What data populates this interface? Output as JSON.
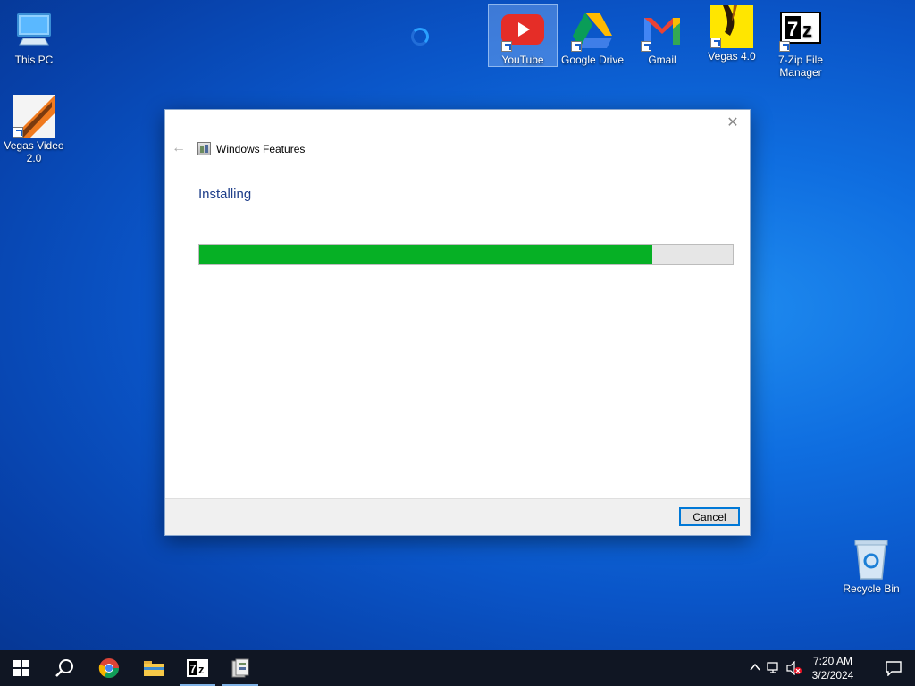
{
  "desktop": {
    "icons": [
      {
        "label": "This PC"
      },
      {
        "label": "Vegas Video 2.0"
      },
      {
        "label": "YouTube"
      },
      {
        "label": "Google Drive"
      },
      {
        "label": "Gmail"
      },
      {
        "label": "Vegas 4.0"
      },
      {
        "label": "7-Zip File Manager"
      },
      {
        "label": "Recycle Bin"
      }
    ]
  },
  "dialog": {
    "title": "Windows Features",
    "heading": "Installing",
    "progress_percent": 85,
    "cancel_label": "Cancel",
    "close_glyph": "✕",
    "back_glyph": "←"
  },
  "taskbar": {
    "clock_time": "7:20 AM",
    "clock_date": "3/2/2024"
  },
  "colors": {
    "progress_fill": "#06b025",
    "accent": "#0078d7",
    "heading": "#1e3e8a"
  }
}
